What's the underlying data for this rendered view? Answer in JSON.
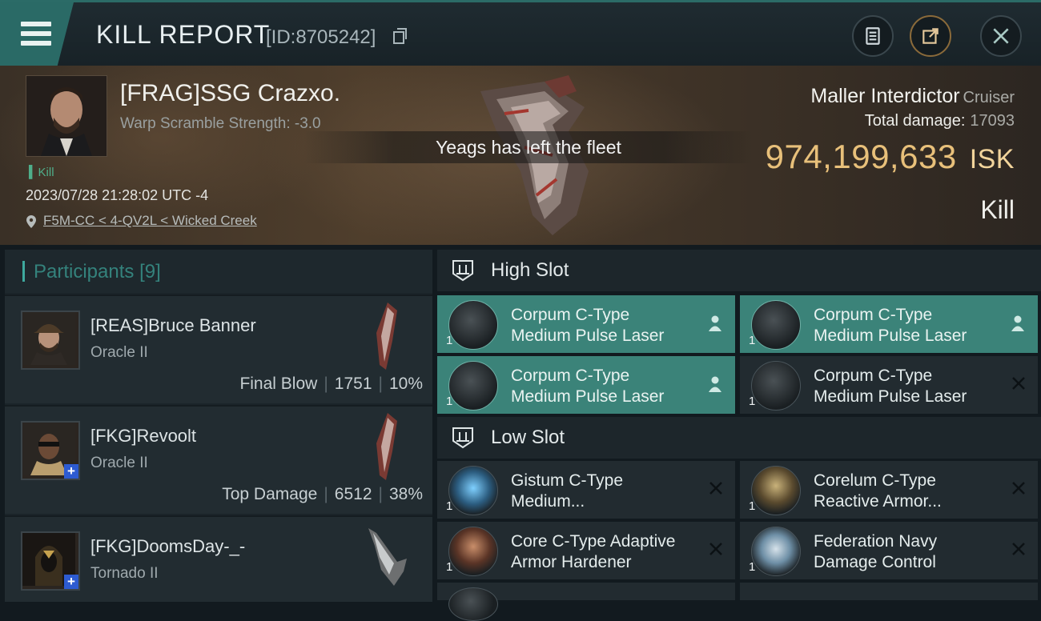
{
  "header": {
    "title": "KILL REPORT",
    "report_id": "[ID:8705242]"
  },
  "victim": {
    "name": "[FRAG]SSG Crazxo.",
    "warp_scramble": "Warp Scramble Strength: -3.0",
    "tag": "Kill",
    "datetime": "2023/07/28 21:28:02 UTC -4",
    "location": "F5M-CC < 4-QV2L < Wicked Creek",
    "ship": "Maller Interdictor",
    "ship_class": "Cruiser",
    "total_damage_label": "Total damage:",
    "total_damage": "17093",
    "isk_value": "974,199,633",
    "isk_unit": "ISK",
    "result": "Kill"
  },
  "notification": "Yeags has left the fleet",
  "participants": {
    "label": "Participants",
    "count": "[9]",
    "rows": [
      {
        "name": "[REAS]Bruce Banner",
        "ship": "Oracle II",
        "tag": "Final Blow",
        "damage": "1751",
        "percent": "10%"
      },
      {
        "name": "[FKG]Revoolt",
        "ship": "Oracle II",
        "tag": "Top Damage",
        "damage": "6512",
        "percent": "38%"
      },
      {
        "name": "[FKG]DoomsDay-_-",
        "ship": "Tornado II",
        "tag": "",
        "damage": "",
        "percent": ""
      }
    ]
  },
  "slots": {
    "high": {
      "label": "High Slot",
      "modules": [
        {
          "line1": "Corpum C-Type",
          "line2": "Medium Pulse Laser",
          "qty": "1",
          "state": "dropped"
        },
        {
          "line1": "Corpum C-Type",
          "line2": "Medium Pulse Laser",
          "qty": "1",
          "state": "dropped"
        },
        {
          "line1": "Corpum C-Type",
          "line2": "Medium Pulse Laser",
          "qty": "1",
          "state": "dropped"
        },
        {
          "line1": "Corpum C-Type",
          "line2": "Medium Pulse Laser",
          "qty": "1",
          "state": "destroyed"
        }
      ]
    },
    "low": {
      "label": "Low Slot",
      "modules": [
        {
          "line1": "Gistum C-Type",
          "line2": "Medium...",
          "qty": "1",
          "state": "destroyed"
        },
        {
          "line1": "Corelum C-Type",
          "line2": "Reactive Armor...",
          "qty": "1",
          "state": "destroyed"
        },
        {
          "line1": "Core C-Type Adaptive",
          "line2": "Armor Hardener",
          "qty": "1",
          "state": "destroyed"
        },
        {
          "line1": "Federation Navy",
          "line2": "Damage Control",
          "qty": "1",
          "state": "destroyed"
        }
      ]
    }
  },
  "colors": {
    "accent": "#3ea99e",
    "dropped_bg": "#3b8379",
    "isk": "#e8c07a"
  },
  "icons": [
    "menu-icon",
    "clipboard-icon",
    "share-icon",
    "close-icon",
    "copy-icon",
    "location-pin-icon",
    "slot-icon",
    "pilot-icon",
    "destroyed-x-icon"
  ]
}
